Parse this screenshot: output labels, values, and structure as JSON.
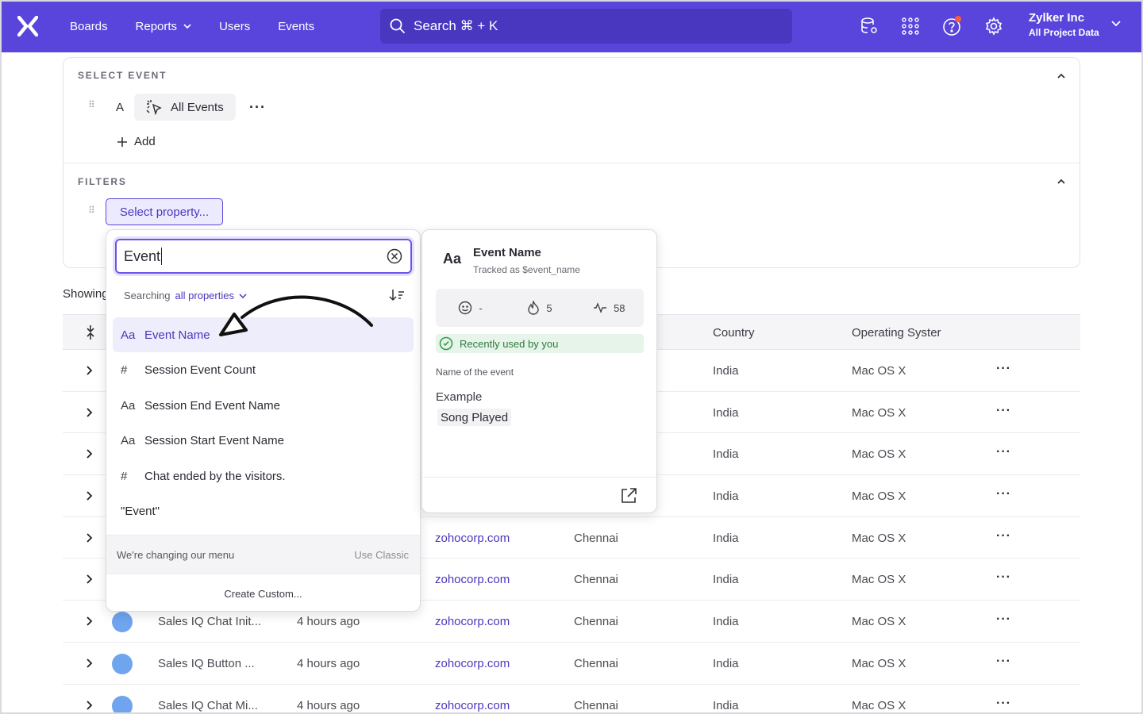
{
  "nav": {
    "items": [
      {
        "label": "Boards",
        "dropdown": false
      },
      {
        "label": "Reports",
        "dropdown": true
      },
      {
        "label": "Users",
        "dropdown": false
      },
      {
        "label": "Events",
        "dropdown": false
      }
    ],
    "search_placeholder": "Search  ⌘ + K",
    "org_name": "Zylker Inc",
    "org_scope": "All Project Data",
    "brand_color": "#5a45dc"
  },
  "panel": {
    "select_event_title": "SELECT EVENT",
    "event_letter": "A",
    "event_label": "All Events",
    "add_label": "Add",
    "filters_title": "FILTERS",
    "select_property_label": "Select property..."
  },
  "showing_label": "Showing",
  "table": {
    "headers": {
      "country": "Country",
      "os": "Operating Syster"
    },
    "rows": [
      {
        "event": "",
        "time": "",
        "domain": "",
        "city": "",
        "country": "India",
        "os": "Mac OS X"
      },
      {
        "event": "",
        "time": "",
        "domain": "",
        "city": "",
        "country": "India",
        "os": "Mac OS X"
      },
      {
        "event": "",
        "time": "",
        "domain": "",
        "city": "",
        "country": "India",
        "os": "Mac OS X"
      },
      {
        "event": "",
        "time": "",
        "domain": "",
        "city": "",
        "country": "India",
        "os": "Mac OS X"
      },
      {
        "event": "",
        "time": "",
        "domain": "zohocorp.com",
        "city": "Chennai",
        "country": "India",
        "os": "Mac OS X"
      },
      {
        "event": "",
        "time": "",
        "domain": "zohocorp.com",
        "city": "Chennai",
        "country": "India",
        "os": "Mac OS X"
      },
      {
        "event": "Sales IQ Chat Init...",
        "time": "4 hours ago",
        "domain": "zohocorp.com",
        "city": "Chennai",
        "country": "India",
        "os": "Mac OS X"
      },
      {
        "event": "Sales IQ Button ...",
        "time": "4 hours ago",
        "domain": "zohocorp.com",
        "city": "Chennai",
        "country": "India",
        "os": "Mac OS X"
      },
      {
        "event": "Sales IQ Chat Mi...",
        "time": "4 hours ago",
        "domain": "zohocorp.com",
        "city": "Chennai",
        "country": "India",
        "os": "Mac OS X"
      }
    ]
  },
  "dropdown": {
    "query": "Event",
    "searching_prefix": "Searching",
    "searching_scope": "all properties",
    "options": [
      {
        "type": "Aa",
        "label": "Event Name",
        "active": true
      },
      {
        "type": "#",
        "label": "Session Event Count",
        "active": false
      },
      {
        "type": "Aa",
        "label": "Session End Event Name",
        "active": false
      },
      {
        "type": "Aa",
        "label": "Session Start Event Name",
        "active": false
      },
      {
        "type": "#",
        "label": "Chat ended by the visitors.",
        "active": false
      },
      {
        "type": "",
        "label": "\"Event\"",
        "active": false
      }
    ],
    "footer_note": "We're changing our menu",
    "footer_classic": "Use Classic",
    "create_custom": "Create Custom..."
  },
  "card": {
    "type": "Aa",
    "title": "Event Name",
    "tracked_as": "Tracked as $event_name",
    "stat_emoji": "-",
    "stat_fire": "5",
    "stat_activity": "58",
    "recent": "Recently used by you",
    "description": "Name of the event",
    "example_label": "Example",
    "example_value": "Song Played"
  }
}
